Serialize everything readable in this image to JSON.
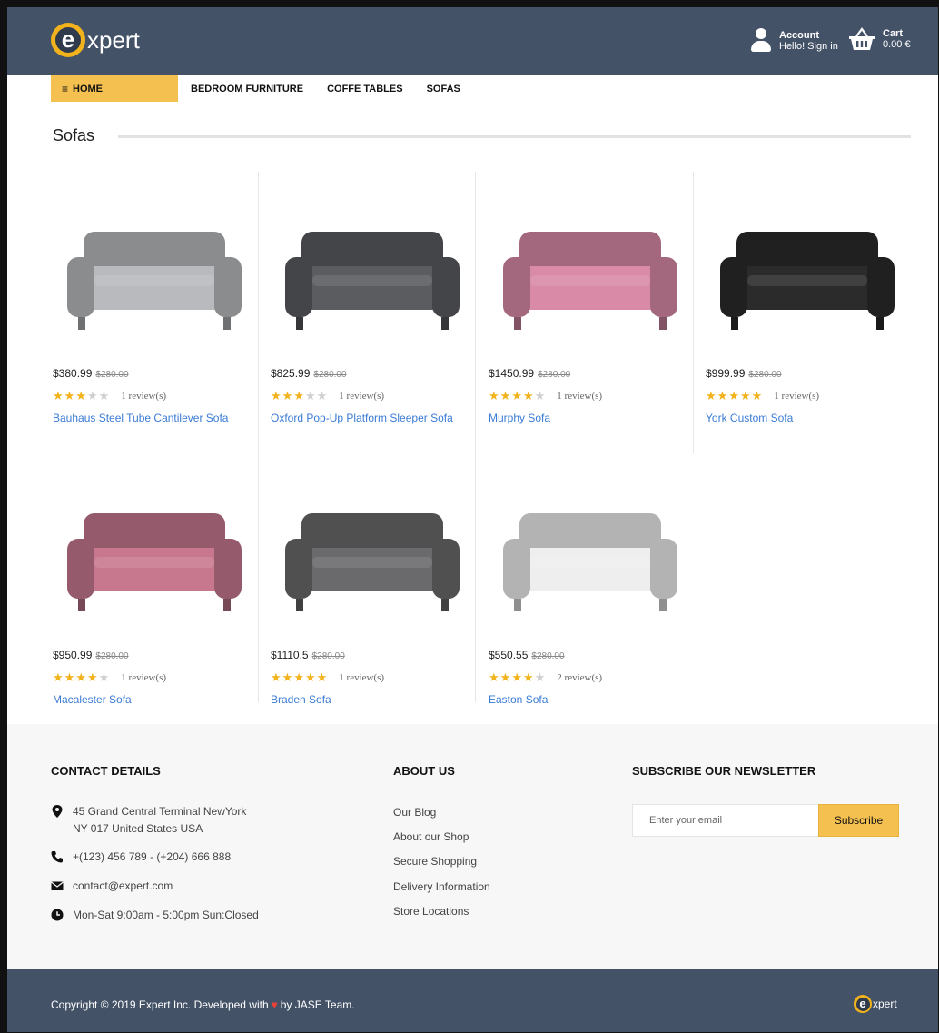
{
  "brand": {
    "logo_letter": "e",
    "logo_text": "xpert",
    "accent": "#f2b21b",
    "header_bg": "#445268"
  },
  "header": {
    "account_label": "Account",
    "account_sub": "Hello! Sign in",
    "cart_label": "Cart",
    "cart_total": "0.00 €"
  },
  "nav": {
    "home": "HOME",
    "items": [
      "BEDROOM FURNITURE",
      "COFFE TABLES",
      "SOFAS"
    ]
  },
  "section": {
    "title": "Sofas"
  },
  "products": [
    {
      "price": "$380.99",
      "old_price": "$280.00",
      "rating": 3,
      "reviews": "1 review(s)",
      "name": "Bauhaus Steel Tube Cantilever Sofa",
      "color": "#b9babd"
    },
    {
      "price": "$825.99",
      "old_price": "$280.00",
      "rating": 3,
      "reviews": "1 review(s)",
      "name": "Oxford Pop-Up Platform Sleeper Sofa",
      "color": "#5b5c60"
    },
    {
      "price": "$1450.99",
      "old_price": "$280.00",
      "rating": 4,
      "reviews": "1 review(s)",
      "name": "Murphy Sofa",
      "color": "#d98aa7"
    },
    {
      "price": "$999.99",
      "old_price": "$280.00",
      "rating": 5,
      "reviews": "1 review(s)",
      "name": "York Custom Sofa",
      "color": "#2b2b2b"
    },
    {
      "price": "$950.99",
      "old_price": "$280.00",
      "rating": 4,
      "reviews": "1 review(s)",
      "name": "Macalester Sofa",
      "color": "#c7788f"
    },
    {
      "price": "$1110.5",
      "old_price": "$280.00",
      "rating": 5,
      "reviews": "1 review(s)",
      "name": "Braden Sofa",
      "color": "#6a6a6c"
    },
    {
      "price": "$550.55",
      "old_price": "$280.00",
      "rating": 4,
      "reviews": "2 review(s)",
      "name": "Easton Sofa",
      "color": "#eeeeee"
    }
  ],
  "footer": {
    "contact_title": "CONTACT DETAILS",
    "address_line1": "45 Grand Central Terminal NewYork",
    "address_line2": "NY 017 United States USA",
    "phone": "+(123) 456 789 - (+204) 666 888",
    "email": "contact@expert.com",
    "hours": "Mon-Sat 9:00am - 5:00pm Sun:Closed",
    "about_title": "ABOUT US",
    "about_links": [
      "Our Blog",
      "About our Shop",
      "Secure Shopping",
      "Delivery Information",
      "Store Locations"
    ],
    "newsletter_title": "SUBSCRIBE OUR NEWSLETTER",
    "email_placeholder": "Enter your email",
    "subscribe_label": "Subscribe"
  },
  "bottom": {
    "copyright_pre": "Copyright © 2019 Expert Inc. Developed with",
    "copyright_post": "by JASE Team.",
    "logo_letter": "e",
    "logo_text": "xpert"
  }
}
